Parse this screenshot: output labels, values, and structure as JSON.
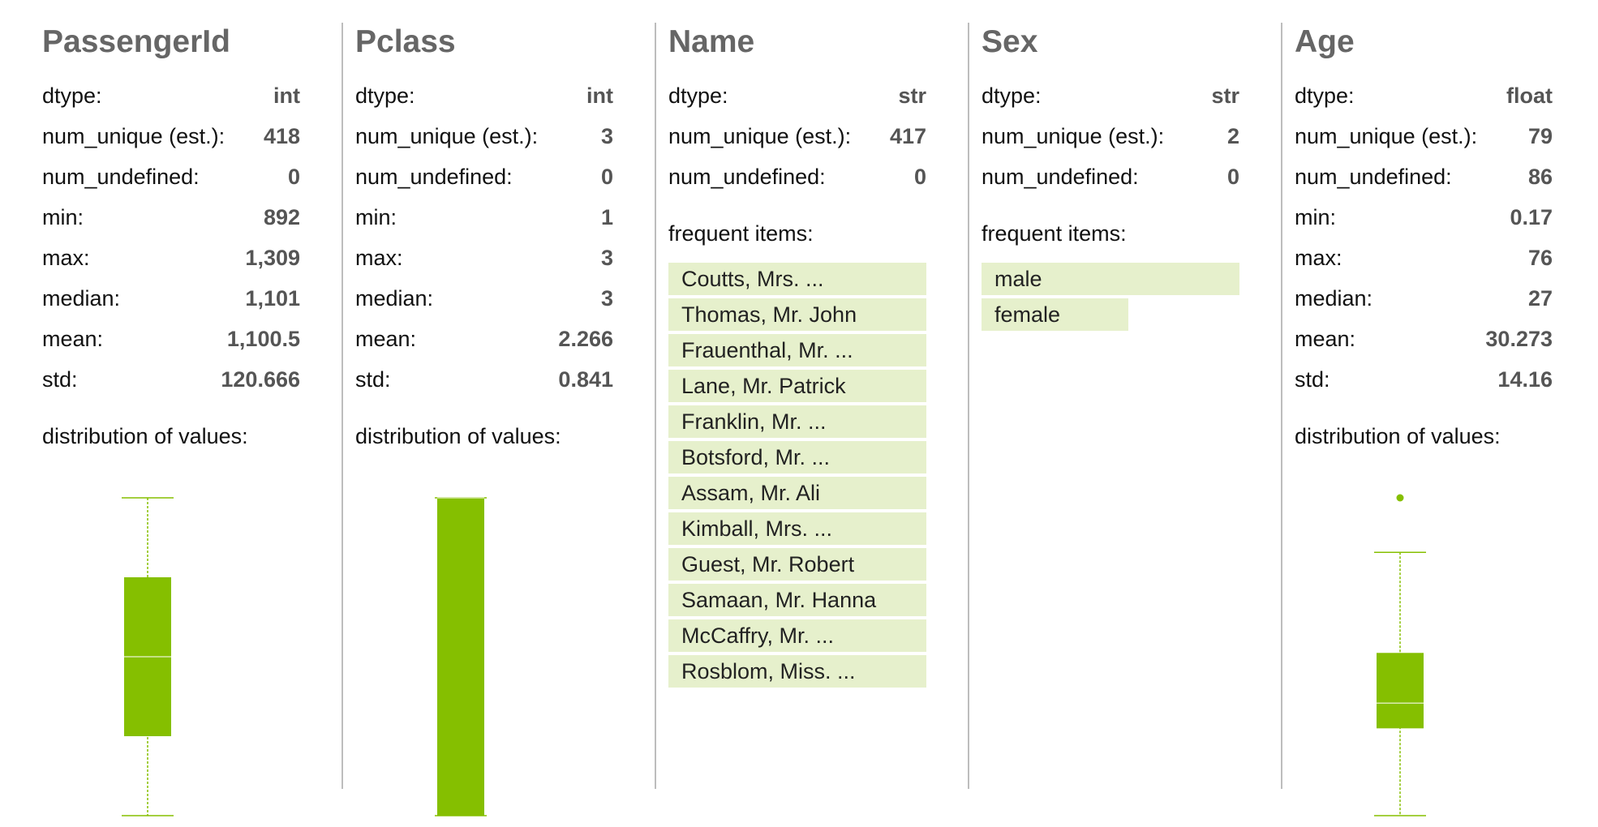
{
  "colors": {
    "accent": "#85bf00",
    "item_bar": "#e6f0cc",
    "divider": "#bdbdbd",
    "title": "#666666"
  },
  "columns": [
    {
      "title": "PassengerId",
      "stats": [
        {
          "label": "dtype:",
          "value": "int"
        },
        {
          "label": "num_unique (est.):",
          "value": "418"
        },
        {
          "label": "num_undefined:",
          "value": "0"
        },
        {
          "label": "min:",
          "value": "892"
        },
        {
          "label": "max:",
          "value": "1,309"
        },
        {
          "label": "median:",
          "value": "1,101"
        },
        {
          "label": "mean:",
          "value": "1,100.5"
        },
        {
          "label": "std:",
          "value": "120.666"
        }
      ],
      "section_label": "distribution of values:",
      "distribution": {
        "type": "boxplot",
        "min": 892,
        "q1": 996.25,
        "median": 1100.5,
        "q3": 1204.75,
        "max": 1309,
        "outliers": []
      }
    },
    {
      "title": "Pclass",
      "stats": [
        {
          "label": "dtype:",
          "value": "int"
        },
        {
          "label": "num_unique (est.):",
          "value": "3"
        },
        {
          "label": "num_undefined:",
          "value": "0"
        },
        {
          "label": "min:",
          "value": "1"
        },
        {
          "label": "max:",
          "value": "3"
        },
        {
          "label": "median:",
          "value": "3"
        },
        {
          "label": "mean:",
          "value": "2.266"
        },
        {
          "label": "std:",
          "value": "0.841"
        }
      ],
      "section_label": "distribution of values:",
      "distribution": {
        "type": "boxplot",
        "min": 1,
        "q1": 1,
        "median": 3,
        "q3": 3,
        "max": 3,
        "outliers": []
      }
    },
    {
      "title": "Name",
      "stats": [
        {
          "label": "dtype:",
          "value": "str"
        },
        {
          "label": "num_unique (est.):",
          "value": "417"
        },
        {
          "label": "num_undefined:",
          "value": "0"
        }
      ],
      "section_label": "frequent items:",
      "frequent_items": [
        {
          "label": "Coutts, Mrs. ...",
          "share": 1.0
        },
        {
          "label": "Thomas, Mr. John",
          "share": 1.0
        },
        {
          "label": "Frauenthal, Mr. ...",
          "share": 1.0
        },
        {
          "label": "Lane, Mr. Patrick",
          "share": 1.0
        },
        {
          "label": "Franklin, Mr. ...",
          "share": 1.0
        },
        {
          "label": "Botsford, Mr. ...",
          "share": 1.0
        },
        {
          "label": "Assam, Mr. Ali",
          "share": 1.0
        },
        {
          "label": "Kimball, Mrs. ...",
          "share": 1.0
        },
        {
          "label": "Guest, Mr. Robert",
          "share": 1.0
        },
        {
          "label": "Samaan, Mr. Hanna",
          "share": 1.0
        },
        {
          "label": "McCaffry, Mr. ...",
          "share": 1.0
        },
        {
          "label": "Rosblom, Miss. ...",
          "share": 1.0
        }
      ]
    },
    {
      "title": "Sex",
      "stats": [
        {
          "label": "dtype:",
          "value": "str"
        },
        {
          "label": "num_unique (est.):",
          "value": "2"
        },
        {
          "label": "num_undefined:",
          "value": "0"
        }
      ],
      "section_label": "frequent items:",
      "frequent_items": [
        {
          "label": "male",
          "share": 1.0
        },
        {
          "label": "female",
          "share": 0.57
        }
      ]
    },
    {
      "title": "Age",
      "stats": [
        {
          "label": "dtype:",
          "value": "float"
        },
        {
          "label": "num_unique (est.):",
          "value": "79"
        },
        {
          "label": "num_undefined:",
          "value": "86"
        },
        {
          "label": "min:",
          "value": "0.17"
        },
        {
          "label": "max:",
          "value": "76"
        },
        {
          "label": "median:",
          "value": "27"
        },
        {
          "label": "mean:",
          "value": "30.273"
        },
        {
          "label": "std:",
          "value": "14.16"
        }
      ],
      "section_label": "distribution of values:",
      "distribution": {
        "type": "boxplot",
        "min": 0.17,
        "q1": 21,
        "median": 27,
        "q3": 39,
        "max": 63,
        "outliers": [
          76
        ]
      }
    }
  ]
}
